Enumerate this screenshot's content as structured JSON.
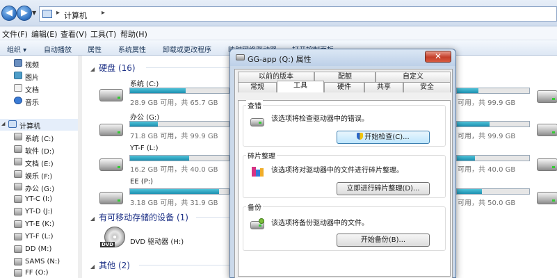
{
  "address": {
    "crumb": "计算机"
  },
  "menu": [
    "文件(F)",
    "编辑(E)",
    "查看(V)",
    "工具(T)",
    "帮助(H)"
  ],
  "toolbar": [
    "组织 ▾",
    "自动播放",
    "属性",
    "系统属性",
    "卸载或更改程序",
    "映射网络驱动器",
    "打开控制面板"
  ],
  "nav": [
    {
      "label": "视频"
    },
    {
      "label": "图片"
    },
    {
      "label": "文档"
    },
    {
      "label": "音乐"
    },
    {
      "label": "计算机"
    },
    {
      "label": "系统 (C:)"
    },
    {
      "label": "软件 (D:)"
    },
    {
      "label": "文档 (E:)"
    },
    {
      "label": "娱乐 (F:)"
    },
    {
      "label": "办公 (G:)"
    },
    {
      "label": "YT-C (I:)"
    },
    {
      "label": "YT-D (J:)"
    },
    {
      "label": "YT-E (K:)"
    },
    {
      "label": "YT-F (L:)"
    },
    {
      "label": "DD (M:)"
    },
    {
      "label": "SAMS (N:)"
    },
    {
      "label": "FF (O:)"
    }
  ],
  "groups": {
    "hdd": "硬盘 (16)",
    "removable": "有可移动存储的设备 (1)",
    "other": "其他 (2)"
  },
  "drives": [
    {
      "name": "系统 (C:)",
      "size": "28.9 GB 可用，共 65.7 GB",
      "used": 0.56
    },
    {
      "name": "办公 (G:)",
      "size": "71.8 GB 可用，共 99.9 GB",
      "used": 0.28
    },
    {
      "name": "YT-F (L:)",
      "size": "16.2 GB 可用，共 40.0 GB",
      "used": 0.6
    },
    {
      "name": "EE (P:)",
      "size": "3.18 GB 可用，共 31.9 GB",
      "used": 0.9
    }
  ],
  "right_sizes": [
    "可用，共 99.9 GB",
    "可用，共 99.9 GB",
    "可用，共 40.0 GB",
    "可用，共 50.0 GB"
  ],
  "dvd": {
    "name": "DVD 驱动器 (H:)",
    "badge": "DVD"
  },
  "dialog": {
    "title": "GG-app (Q:) 属性",
    "close": "✕",
    "tabs_row1": [
      "以前的版本",
      "配额",
      "自定义"
    ],
    "tabs_row2": [
      "常规",
      "工具",
      "硬件",
      "共享",
      "安全"
    ],
    "sections": [
      {
        "title": "查错",
        "desc": "该选项将检查驱动器中的错误。",
        "button": "开始检查(C)..."
      },
      {
        "title": "碎片整理",
        "desc": "该选项将对驱动器中的文件进行碎片整理。",
        "button": "立即进行碎片整理(D)..."
      },
      {
        "title": "备份",
        "desc": "该选项将备份驱动器中的文件。",
        "button": "开始备份(B)..."
      }
    ]
  },
  "colors": {
    "accent": "#1c8fb0",
    "group_title": "#1e3287"
  }
}
